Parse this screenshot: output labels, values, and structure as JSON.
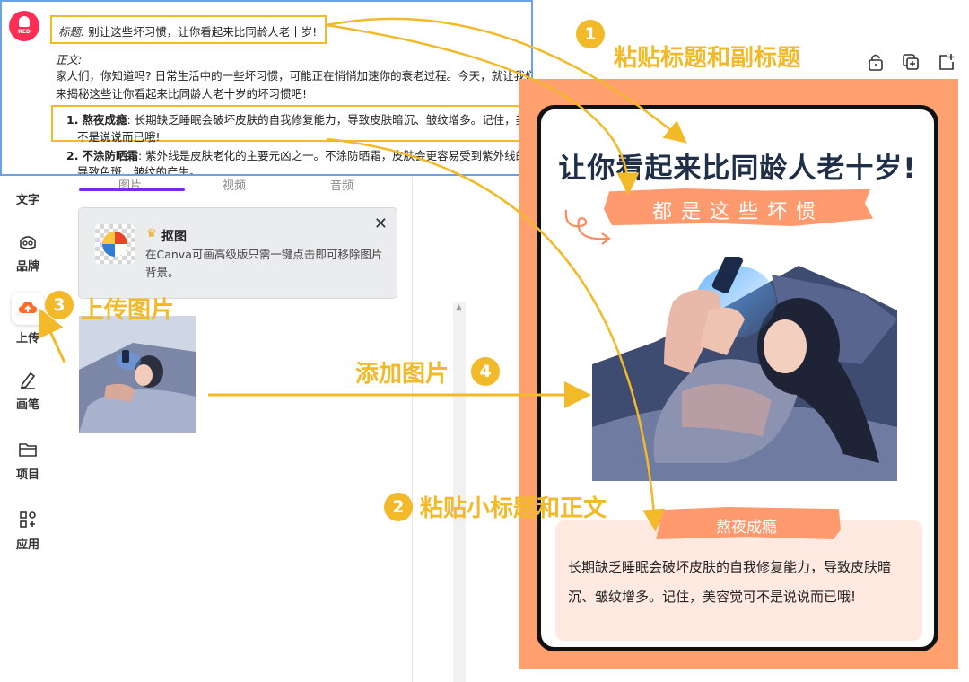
{
  "overlay": {
    "brand_badge": "RED",
    "title_prefix": "标题:",
    "title_value": "别让这些坏习惯，让你看起来比同龄人老十岁!",
    "body_prefix": "正文:",
    "body_line1": "家人们，你知道吗? 日常生活中的一些坏习惯，可能正在悄悄加速你的衰老过程。今天，就让我们一起",
    "body_line2": "来揭秘这些让你看起来比同龄人老十岁的坏习惯吧!",
    "item1_index": "1.",
    "item1_title": "熬夜成瘾",
    "item1_line1": ": 长期缺乏睡眠会破坏皮肤的自我修复能力，导致皮肤暗沉、皱纹增多。记住，美容觉可",
    "item1_line2": "不是说说而已哦!",
    "item2_index": "2.",
    "item2_title": "不涂防晒霜",
    "item2_line1": ": 紫外线是皮肤老化的主要元凶之一。不涂防晒霜，皮肤会更容易受到紫外线的伤害，",
    "item2_line2": "导致色斑、皱纹的产生。"
  },
  "sidebar": {
    "items": [
      {
        "label": "文字",
        "icon": "text-icon"
      },
      {
        "label": "品牌",
        "icon": "brand-icon"
      },
      {
        "label": "上传",
        "icon": "upload-cloud-icon"
      },
      {
        "label": "画笔",
        "icon": "pen-icon"
      },
      {
        "label": "项目",
        "icon": "folder-icon"
      },
      {
        "label": "应用",
        "icon": "apps-icon"
      }
    ]
  },
  "panel": {
    "tabs": [
      "图片",
      "视频",
      "音频"
    ],
    "notice": {
      "title": "抠图",
      "text": "在Canva可画高级版只需一键点击即可移除图片背景。",
      "close": "✕"
    }
  },
  "canvas": {
    "title": "让你看起来比同龄人老十岁!",
    "subtitle": "都是这些坏惯",
    "section_title": "熬夜成瘾",
    "body": "长期缺乏睡眠会破坏皮肤的自我修复能力，导致皮肤暗沉、皱纹增多。记住，美容觉可不是说说而已哦!"
  },
  "annotations": [
    {
      "num": "1",
      "label": "粘贴标题和副标题"
    },
    {
      "num": "2",
      "label": "粘贴小标题和正文"
    },
    {
      "num": "3",
      "label": "上传图片"
    },
    {
      "num": "4",
      "label": "添加图片"
    }
  ],
  "colors": {
    "accent": "#f2b928",
    "canvas_bg": "#ffa06e",
    "brush": "#ff9a6e",
    "title": "#1f2f48",
    "tab_active": "#7d2ae8",
    "brand_red": "#ff2e55"
  }
}
